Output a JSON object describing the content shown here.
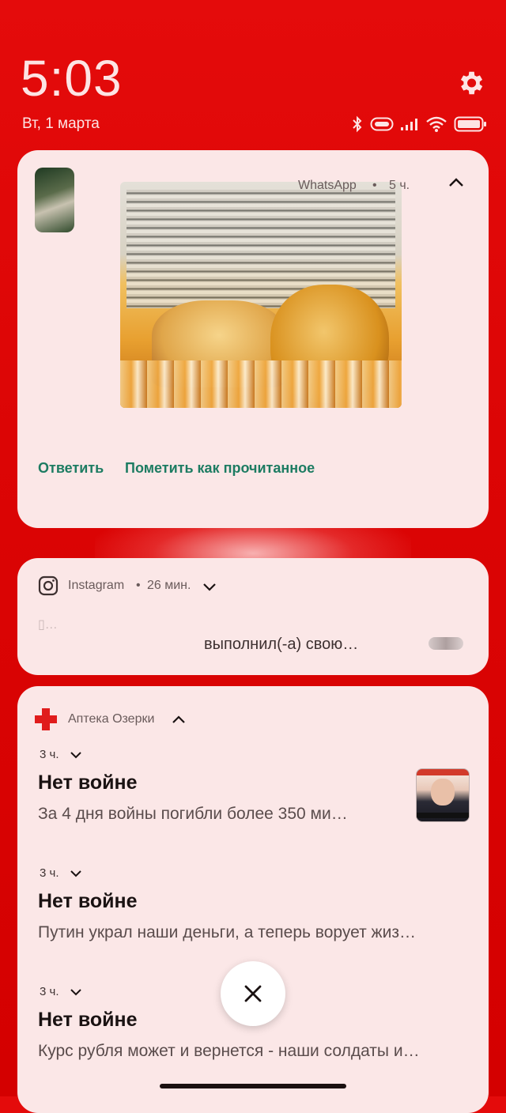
{
  "lockscreen": {
    "time": "5:03",
    "date": "Вт, 1 марта"
  },
  "notifications": {
    "whatsapp": {
      "app_name": "WhatsApp",
      "age": "5 ч.",
      "actions": [
        "Ответить",
        "Пометить как прочитанное"
      ]
    },
    "instagram": {
      "app_name": "Instagram",
      "age": "26 мин.",
      "text": "выполнил(-а) свою…"
    },
    "apteka": {
      "app_name": "Аптека Озерки",
      "items": [
        {
          "age": "3 ч.",
          "title": "Нет войне",
          "body": "За 4 дня войны погибли более 350 ми…"
        },
        {
          "age": "3 ч.",
          "title": "Нет войне",
          "body": "Путин украл наши деньги, а теперь ворует жиз…"
        },
        {
          "age": "3 ч.",
          "title": "Нет войне",
          "body": "Курс рубля может и вернется - наши солдаты и…"
        }
      ]
    }
  },
  "colors": {
    "background": "#dc0505",
    "card": "#fbe7e7",
    "action_text": "#1d7c62",
    "apteka_cross": "#e01c1c"
  },
  "icons": [
    "gear-icon",
    "bluetooth-icon",
    "battery-saver-icon",
    "signal-icon",
    "wifi-icon",
    "battery-icon",
    "instagram-icon",
    "pharmacy-cross-icon",
    "chevron-up-icon",
    "chevron-down-icon",
    "close-icon"
  ]
}
